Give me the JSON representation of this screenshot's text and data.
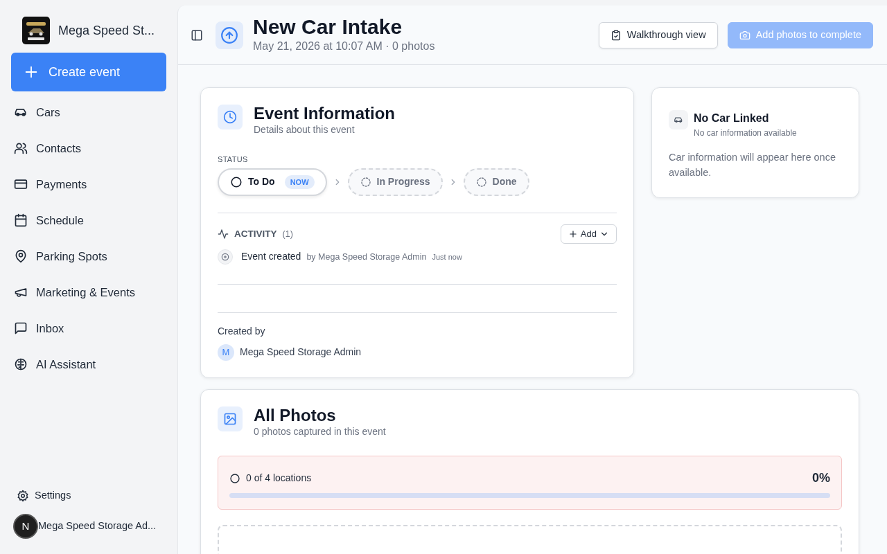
{
  "app": {
    "name": "Mega Speed St..."
  },
  "sidebar": {
    "create_button": "Create event",
    "items": [
      {
        "label": "Cars",
        "selected": false
      },
      {
        "label": "Contacts",
        "selected": false
      },
      {
        "label": "Payments",
        "selected": false
      },
      {
        "label": "Schedule",
        "selected": false
      },
      {
        "label": "Parking Spots",
        "selected": false
      },
      {
        "label": "Marketing & Events",
        "selected": false
      },
      {
        "label": "Inbox",
        "selected": false
      },
      {
        "label": "AI Assistant",
        "selected": false
      }
    ],
    "settings": "Settings",
    "user": {
      "avatar": "N",
      "name": "Mega Speed Storage Ad..."
    }
  },
  "header": {
    "title": "New Car Intake",
    "subtitle": "May 21, 2026 at 10:07 AM · 0 photos",
    "buttons": [
      {
        "label": "Walkthrough view",
        "kind": "secondary",
        "disabled": false
      },
      {
        "label": "Add photos to complete",
        "kind": "primary",
        "disabled": true
      }
    ]
  },
  "event_info": {
    "title": "Event Information",
    "subtitle": "Details about this event",
    "status": {
      "label": "STATUS",
      "steps": [
        {
          "label": "To Do",
          "selected": true,
          "badge": "NOW"
        },
        {
          "label": "In Progress",
          "selected": false
        },
        {
          "label": "Done",
          "selected": false
        }
      ]
    },
    "activity": {
      "label": "ACTIVITY",
      "count": "(1)",
      "add_button": "Add",
      "items": [
        {
          "action": "Event created",
          "by": "by Mega Speed Storage Admin",
          "time": "Just now"
        }
      ]
    },
    "created_by": {
      "label": "Created by",
      "avatar": "M",
      "name": "Mega Speed Storage Admin"
    }
  },
  "car": {
    "title": "No Car Linked",
    "subtitle": "No car information available",
    "message": "Car information will appear here once available."
  },
  "photos": {
    "title": "All Photos",
    "subtitle": "0 photos captured in this event",
    "progress": {
      "label": "0 of 4 locations",
      "percent": "0%",
      "level": 0
    }
  }
}
